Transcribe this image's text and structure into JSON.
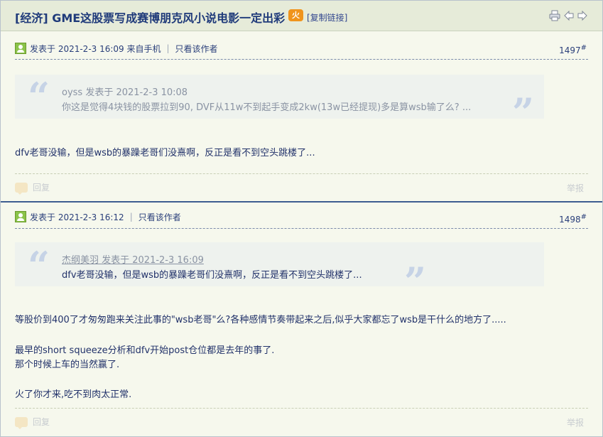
{
  "thread": {
    "title": "[经济] GME这股票写成赛博朋克风小说电影一定出彩",
    "hot_badge": "火",
    "copy_link": "[复制链接]",
    "icons": [
      "print-icon",
      "prev-arrow-icon",
      "next-arrow-icon"
    ]
  },
  "posts": [
    {
      "posted": "发表于 2021-2-3 16:09 来自手机",
      "pipe": "|",
      "author_only": "只看该作者",
      "floor": "1497",
      "floor_mark": "#",
      "quote": {
        "head": "oyss 发表于 2021-2-3 10:08",
        "body": "你这是觉得4块钱的股票拉到90, DVF从11w不到起手变成2kw(13w已经提现)多是算wsb输了么? ..."
      },
      "lines": [
        "dfv老哥没输，但是wsb的暴躁老哥们没熹啊，反正是看不到空头跳楼了..."
      ],
      "reply": "回复",
      "report": "举报"
    },
    {
      "posted": "发表于 2021-2-3 16:12",
      "pipe": "|",
      "author_only": "只看该作者",
      "floor": "1498",
      "floor_mark": "#",
      "quote": {
        "head": "杰纲美羽 发表于 2021-2-3 16:09",
        "body": "dfv老哥没输，但是wsb的暴躁老哥们没熹啊，反正是看不到空头跳楼了..."
      },
      "lines": [
        "等股价到400了才匆匆跑来关注此事的\"wsb老哥\"么?各种感情节奏带起来之后,似乎大家都忘了wsb是干什么的地方了.....",
        "最早的short squeeze分析和dfv开始post仓位都是去年的事了.",
        "那个时候上车的当然赢了.",
        "火了你才来,吃不到肉太正常."
      ],
      "reply": "回复",
      "report": "举报"
    }
  ]
}
